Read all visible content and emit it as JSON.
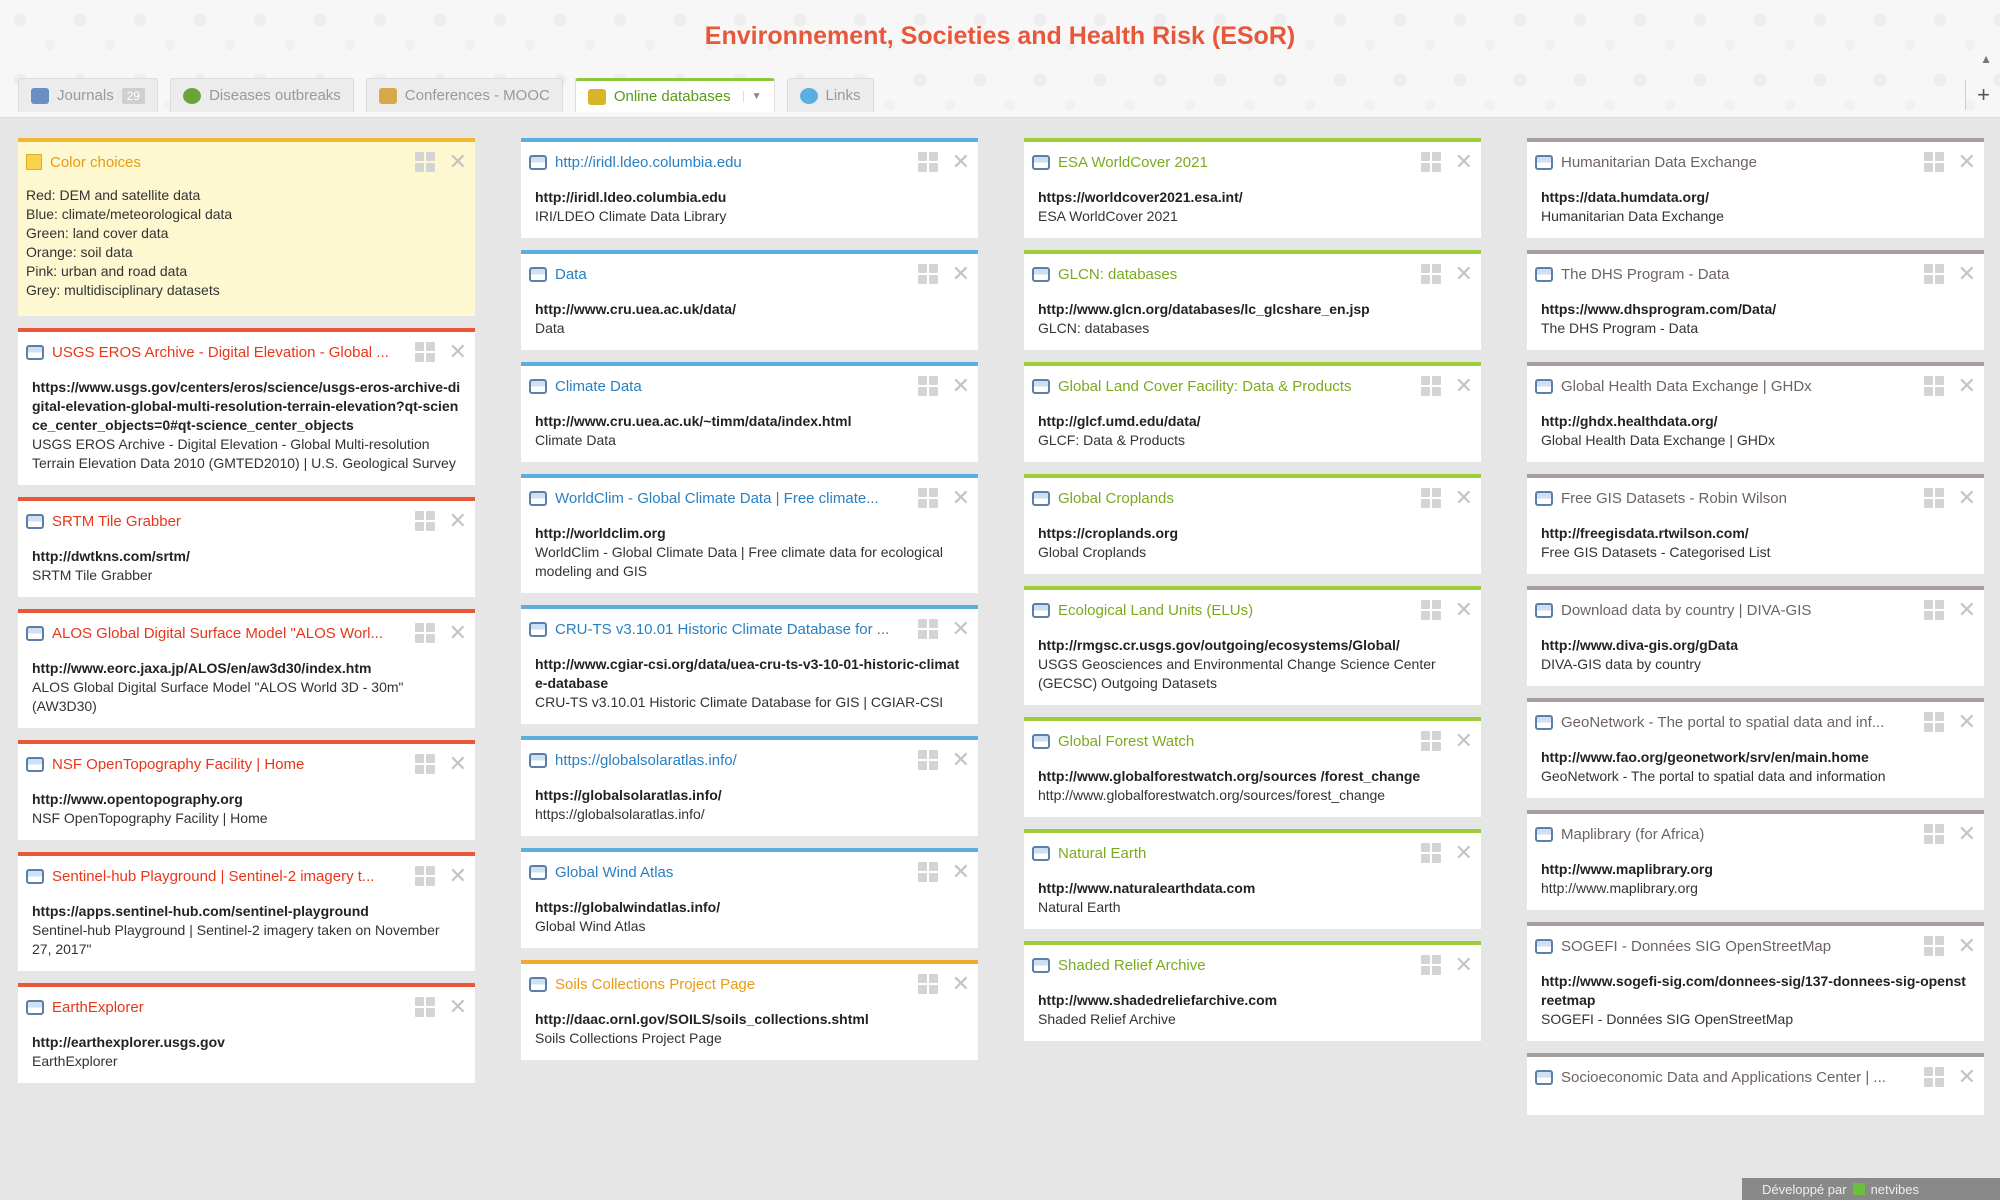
{
  "site_title": "Environnement, Societies and Health Risk (ESoR)",
  "tabs": [
    {
      "label": "Journals",
      "badge": "29",
      "icon": "book-icon",
      "color": "#6a8fc4"
    },
    {
      "label": "Diseases outbreaks",
      "icon": "virus-icon",
      "color": "#6aa33a"
    },
    {
      "label": "Conferences - MOOC",
      "icon": "calendar-icon",
      "color": "#d9a84a"
    },
    {
      "label": "Online databases",
      "icon": "database-icon",
      "color": "#d9b52a",
      "active": true
    },
    {
      "label": "Links",
      "icon": "globe-icon",
      "color": "#5aaee0"
    }
  ],
  "footer": {
    "text1": "Développé par",
    "text2": "netvibes"
  },
  "col1": [
    {
      "type": "note",
      "title": "Color choices",
      "lines": [
        "Red: DEM and satellite data",
        "Blue: climate/meteorological data",
        "Green: land cover data",
        "Orange: soil data",
        "Pink: urban and road data",
        "Grey: multidisciplinary datasets"
      ]
    },
    {
      "title": "USGS EROS Archive - Digital Elevation - Global ...",
      "link": "https://www.usgs.gov/centers/eros/science/usgs-eros-archive-digital-elevation-global-multi-resolution-terrain-elevation?qt-science_center_objects=0#qt-science_center_objects",
      "desc": "USGS EROS Archive - Digital Elevation - Global Multi-resolution Terrain Elevation Data 2010 (GMTED2010) | U.S. Geological Survey"
    },
    {
      "title": "SRTM Tile Grabber",
      "link": "http://dwtkns.com/srtm/",
      "desc": "SRTM Tile Grabber"
    },
    {
      "title": "ALOS Global Digital Surface Model \"ALOS Worl...",
      "link": "http://www.eorc.jaxa.jp/ALOS/en/aw3d30/index.htm",
      "desc": "ALOS Global Digital Surface Model \"ALOS World 3D - 30m\" (AW3D30)"
    },
    {
      "title": "NSF OpenTopography Facility | Home",
      "link": "http://www.opentopography.org",
      "desc": "NSF OpenTopography Facility | Home"
    },
    {
      "title": "Sentinel-hub Playground | Sentinel-2 imagery t...",
      "link": "https://apps.sentinel-hub.com/sentinel-playground",
      "desc": "Sentinel-hub Playground | Sentinel-2 imagery taken on November 27, 2017\""
    },
    {
      "title": "EarthExplorer",
      "link": "http://earthexplorer.usgs.gov",
      "desc": "EarthExplorer"
    }
  ],
  "col2": [
    {
      "title": "http://iridl.ldeo.columbia.edu",
      "link": "http://iridl.ldeo.columbia.edu",
      "desc": "IRI/LDEO Climate Data Library"
    },
    {
      "title": "Data",
      "link": "http://www.cru.uea.ac.uk/data/",
      "desc": "Data"
    },
    {
      "title": "Climate Data",
      "link": "http://www.cru.uea.ac.uk/~timm/data/index.html",
      "desc": "Climate Data"
    },
    {
      "title": "WorldClim - Global Climate Data | Free climate...",
      "link": "http://worldclim.org",
      "desc": "WorldClim - Global Climate Data | Free climate data for ecological modeling and GIS"
    },
    {
      "title": "CRU-TS v3.10.01 Historic Climate Database for ...",
      "link": "http://www.cgiar-csi.org/data/uea-cru-ts-v3-10-01-historic-climate-database",
      "desc": "CRU-TS v3.10.01 Historic Climate Database for GIS | CGIAR-CSI"
    },
    {
      "title": "https://globalsolaratlas.info/",
      "link": "https://globalsolaratlas.info/",
      "desc": "https://globalsolaratlas.info/"
    },
    {
      "title": "Global Wind Atlas",
      "link": "https://globalwindatlas.info/",
      "desc": "Global Wind Atlas"
    },
    {
      "title": "Soils Collections Project Page",
      "link": "http://daac.ornl.gov/SOILS/soils_collections.shtml",
      "desc": "Soils Collections Project Page"
    }
  ],
  "col3": [
    {
      "title": "ESA WorldCover 2021",
      "link": "https://worldcover2021.esa.int/",
      "desc": "ESA WorldCover 2021"
    },
    {
      "title": "GLCN: databases",
      "link": "http://www.glcn.org/databases/lc_glcshare_en.jsp",
      "desc": "GLCN: databases"
    },
    {
      "title": "Global Land Cover Facility: Data & Products",
      "link": "http://glcf.umd.edu/data/",
      "desc": "GLCF: Data & Products"
    },
    {
      "title": "Global Croplands",
      "link": "https://croplands.org",
      "desc": "Global Croplands"
    },
    {
      "title": "Ecological Land Units (ELUs)",
      "link": "http://rmgsc.cr.usgs.gov/outgoing/ecosystems/Global/",
      "desc": "USGS Geosciences and Environmental Change Science Center (GECSC) Outgoing Datasets"
    },
    {
      "title": "Global Forest Watch",
      "link": "http://www.globalforestwatch.org/sources /forest_change",
      "desc": "http://www.globalforestwatch.org/sources/forest_change"
    },
    {
      "title": "Natural Earth",
      "link": "http://www.naturalearthdata.com",
      "desc": "Natural Earth"
    },
    {
      "title": "Shaded Relief Archive",
      "link": "http://www.shadedreliefarchive.com",
      "desc": "Shaded Relief Archive"
    }
  ],
  "col4": [
    {
      "title": "Humanitarian Data Exchange",
      "link": "https://data.humdata.org/",
      "desc": "Humanitarian Data Exchange"
    },
    {
      "title": "The DHS Program - Data",
      "link": "https://www.dhsprogram.com/Data/",
      "desc": "The DHS Program - Data"
    },
    {
      "title": "Global Health Data Exchange | GHDx",
      "link": "http://ghdx.healthdata.org/",
      "desc": "Global Health Data Exchange | GHDx"
    },
    {
      "title": "Free GIS Datasets - Robin Wilson",
      "link": "http://freegisdata.rtwilson.com/",
      "desc": "Free GIS Datasets - Categorised List"
    },
    {
      "title": "Download data by country | DIVA-GIS",
      "link": "http://www.diva-gis.org/gData",
      "desc": "DIVA-GIS data by country"
    },
    {
      "title": "GeoNetwork - The portal to spatial data and inf...",
      "link": "http://www.fao.org/geonetwork/srv/en/main.home",
      "desc": "GeoNetwork - The portal to spatial data and information"
    },
    {
      "title": "Maplibrary (for Africa)",
      "link": "http://www.maplibrary.org",
      "desc": "http://www.maplibrary.org"
    },
    {
      "title": "SOGEFI - Données SIG OpenStreetMap",
      "link": "http://www.sogefi-sig.com/donnees-sig/137-donnees-sig-openstreetmap",
      "desc": "SOGEFI - Données SIG OpenStreetMap"
    },
    {
      "title": "Socioeconomic Data and Applications Center | ...",
      "link": "",
      "desc": ""
    }
  ]
}
